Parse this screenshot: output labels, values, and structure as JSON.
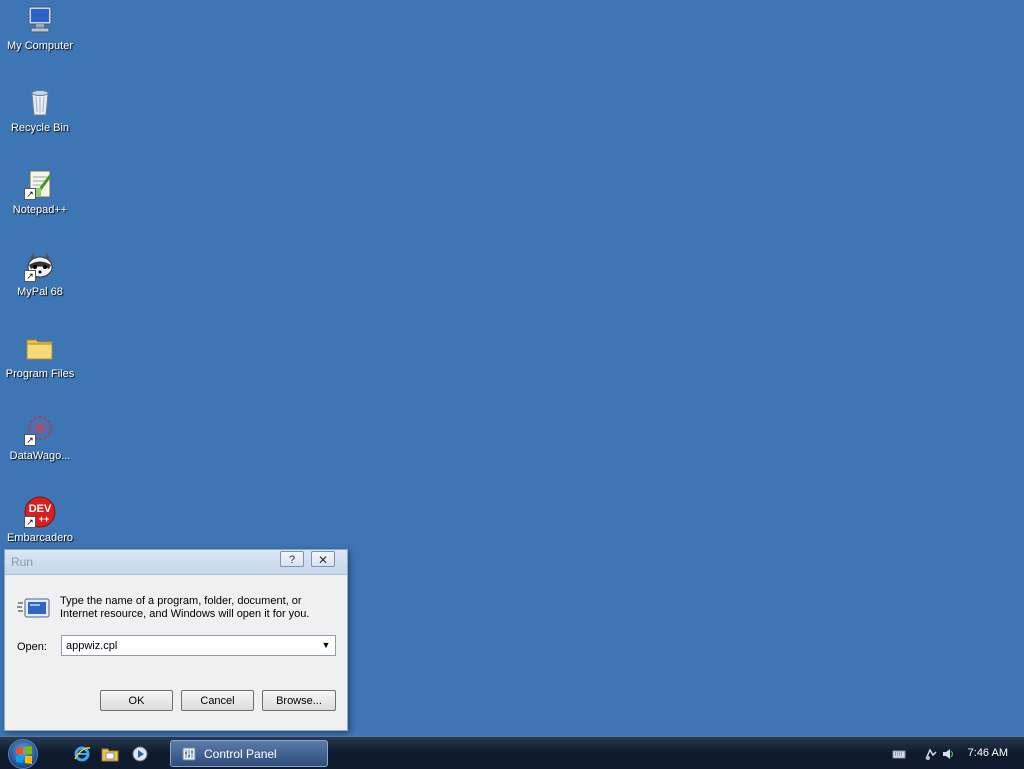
{
  "desktop": {
    "icons": [
      {
        "label": "My Computer",
        "icon": "computer-icon"
      },
      {
        "label": "Recycle Bin",
        "icon": "recycle-bin-icon"
      },
      {
        "label": "Notepad++",
        "icon": "notepad-plus-plus-icon"
      },
      {
        "label": "MyPal 68",
        "icon": "mypal-icon"
      },
      {
        "label": "Program Files",
        "icon": "folder-icon"
      },
      {
        "label": "DataWago...",
        "icon": "datawagon-icon"
      },
      {
        "label": "Embarcadero Dev-C++",
        "icon": "devcpp-icon",
        "badge": "DEV"
      }
    ]
  },
  "run_dialog": {
    "title": "Run",
    "help_label": "?",
    "close_label": "☒",
    "description": "Type the name of a program, folder, document, or Internet resource, and Windows will open it for you.",
    "open_label": "Open:",
    "open_value": "appwiz.cpl",
    "ok_label": "OK",
    "cancel_label": "Cancel",
    "browse_label": "Browse..."
  },
  "taskbar": {
    "start_icon": "windows-start-orb",
    "quick_launch": [
      "internet-explorer-icon",
      "windows-explorer-icon",
      "media-player-icon"
    ],
    "active_window_label": "Control Panel",
    "clock": "7:46 AM",
    "tray_icons": [
      "keyboard-icon",
      "network-icon",
      "volume-icon"
    ]
  },
  "colors": {
    "desktop_background": "#3e76b5",
    "taskbar": "#0d1a2c"
  }
}
